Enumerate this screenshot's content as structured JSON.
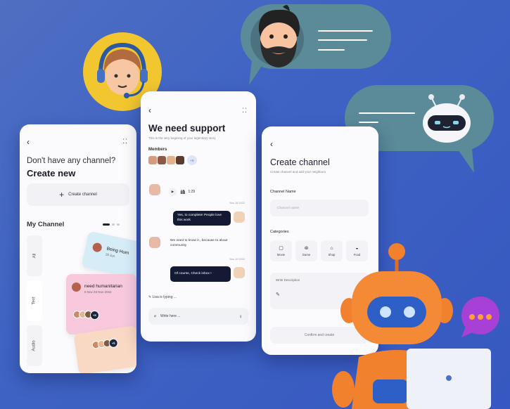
{
  "colors": {
    "background": "#3f63c4",
    "bubble_teal": "#5b8a98",
    "robot_orange": "#f2812e",
    "dark_bubble": "#141a33",
    "support_avatar_bg": "#f2c62f"
  },
  "phone1": {
    "back_icon": "chevron-left-icon",
    "menu_icon": "grid-dots-icon",
    "question": "Don't have any channel?",
    "heading": "Create new",
    "create_button": "Create channel",
    "section_title": "My Channel",
    "tabs": [
      "All",
      "Text",
      "Audio"
    ],
    "cards": [
      {
        "title": "Being Hum",
        "meta": "25 Jun"
      },
      {
        "title": "need humanitarian",
        "meta": "5 Nov 23 Nov 2022"
      },
      {
        "title": "",
        "meta": ""
      }
    ],
    "card_more": "+5",
    "card_more2": "+5",
    "card_more3": "+5"
  },
  "phone2": {
    "title": "We need support",
    "subtitle": "This is the very begining of your legendary story",
    "members_label": "Members",
    "members_more": "+5",
    "audio_duration": "1:29",
    "timestamps": [
      "Nov 18 2022",
      "Nov 19 2022"
    ],
    "messages": [
      {
        "text": "Yes, to complete! People love this work",
        "dark": true
      },
      {
        "text": "We need to know it , because to about community",
        "dark": false
      },
      {
        "text": "Of course, Check inbox !",
        "dark": true
      }
    ],
    "typing": "Lisa is typing ...",
    "input_placeholder": "Write here ..."
  },
  "phone3": {
    "title": "Create channel",
    "subtitle": "Create channel and add your neighbors",
    "channel_name_label": "Channel Name",
    "channel_name_placeholder": "Channel name",
    "categories_label": "Categories",
    "categories": [
      {
        "label": "Movie",
        "icon": "movie-icon"
      },
      {
        "label": "Game",
        "icon": "game-icon"
      },
      {
        "label": "Shop",
        "icon": "shop-icon"
      },
      {
        "label": "Food",
        "icon": "food-icon"
      }
    ],
    "description_label": "Write Description",
    "confirm_button": "Confirm and create"
  },
  "decor": {
    "support_agent": "headset-agent-avatar",
    "bearded_man": "bearded-man-avatar",
    "robot_head": "robot-head-icon",
    "robot_character": "orange-robot-with-laptop",
    "chat_icon": "purple-chat-bubble-icon"
  }
}
